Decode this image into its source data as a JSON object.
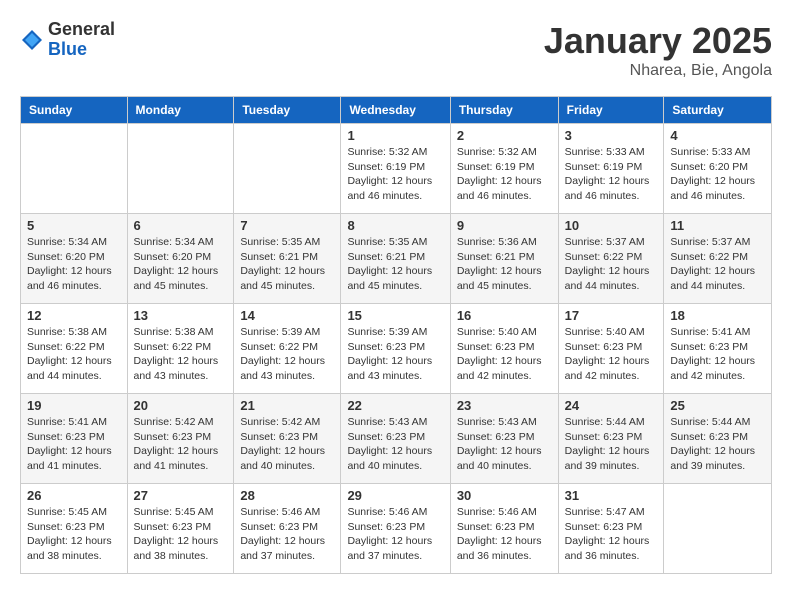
{
  "logo": {
    "general": "General",
    "blue": "Blue"
  },
  "header": {
    "month": "January 2025",
    "location": "Nharea, Bie, Angola"
  },
  "weekdays": [
    "Sunday",
    "Monday",
    "Tuesday",
    "Wednesday",
    "Thursday",
    "Friday",
    "Saturday"
  ],
  "weeks": [
    [
      {
        "day": "",
        "info": ""
      },
      {
        "day": "",
        "info": ""
      },
      {
        "day": "",
        "info": ""
      },
      {
        "day": "1",
        "info": "Sunrise: 5:32 AM\nSunset: 6:19 PM\nDaylight: 12 hours\nand 46 minutes."
      },
      {
        "day": "2",
        "info": "Sunrise: 5:32 AM\nSunset: 6:19 PM\nDaylight: 12 hours\nand 46 minutes."
      },
      {
        "day": "3",
        "info": "Sunrise: 5:33 AM\nSunset: 6:19 PM\nDaylight: 12 hours\nand 46 minutes."
      },
      {
        "day": "4",
        "info": "Sunrise: 5:33 AM\nSunset: 6:20 PM\nDaylight: 12 hours\nand 46 minutes."
      }
    ],
    [
      {
        "day": "5",
        "info": "Sunrise: 5:34 AM\nSunset: 6:20 PM\nDaylight: 12 hours\nand 46 minutes."
      },
      {
        "day": "6",
        "info": "Sunrise: 5:34 AM\nSunset: 6:20 PM\nDaylight: 12 hours\nand 45 minutes."
      },
      {
        "day": "7",
        "info": "Sunrise: 5:35 AM\nSunset: 6:21 PM\nDaylight: 12 hours\nand 45 minutes."
      },
      {
        "day": "8",
        "info": "Sunrise: 5:35 AM\nSunset: 6:21 PM\nDaylight: 12 hours\nand 45 minutes."
      },
      {
        "day": "9",
        "info": "Sunrise: 5:36 AM\nSunset: 6:21 PM\nDaylight: 12 hours\nand 45 minutes."
      },
      {
        "day": "10",
        "info": "Sunrise: 5:37 AM\nSunset: 6:22 PM\nDaylight: 12 hours\nand 44 minutes."
      },
      {
        "day": "11",
        "info": "Sunrise: 5:37 AM\nSunset: 6:22 PM\nDaylight: 12 hours\nand 44 minutes."
      }
    ],
    [
      {
        "day": "12",
        "info": "Sunrise: 5:38 AM\nSunset: 6:22 PM\nDaylight: 12 hours\nand 44 minutes."
      },
      {
        "day": "13",
        "info": "Sunrise: 5:38 AM\nSunset: 6:22 PM\nDaylight: 12 hours\nand 43 minutes."
      },
      {
        "day": "14",
        "info": "Sunrise: 5:39 AM\nSunset: 6:22 PM\nDaylight: 12 hours\nand 43 minutes."
      },
      {
        "day": "15",
        "info": "Sunrise: 5:39 AM\nSunset: 6:23 PM\nDaylight: 12 hours\nand 43 minutes."
      },
      {
        "day": "16",
        "info": "Sunrise: 5:40 AM\nSunset: 6:23 PM\nDaylight: 12 hours\nand 42 minutes."
      },
      {
        "day": "17",
        "info": "Sunrise: 5:40 AM\nSunset: 6:23 PM\nDaylight: 12 hours\nand 42 minutes."
      },
      {
        "day": "18",
        "info": "Sunrise: 5:41 AM\nSunset: 6:23 PM\nDaylight: 12 hours\nand 42 minutes."
      }
    ],
    [
      {
        "day": "19",
        "info": "Sunrise: 5:41 AM\nSunset: 6:23 PM\nDaylight: 12 hours\nand 41 minutes."
      },
      {
        "day": "20",
        "info": "Sunrise: 5:42 AM\nSunset: 6:23 PM\nDaylight: 12 hours\nand 41 minutes."
      },
      {
        "day": "21",
        "info": "Sunrise: 5:42 AM\nSunset: 6:23 PM\nDaylight: 12 hours\nand 40 minutes."
      },
      {
        "day": "22",
        "info": "Sunrise: 5:43 AM\nSunset: 6:23 PM\nDaylight: 12 hours\nand 40 minutes."
      },
      {
        "day": "23",
        "info": "Sunrise: 5:43 AM\nSunset: 6:23 PM\nDaylight: 12 hours\nand 40 minutes."
      },
      {
        "day": "24",
        "info": "Sunrise: 5:44 AM\nSunset: 6:23 PM\nDaylight: 12 hours\nand 39 minutes."
      },
      {
        "day": "25",
        "info": "Sunrise: 5:44 AM\nSunset: 6:23 PM\nDaylight: 12 hours\nand 39 minutes."
      }
    ],
    [
      {
        "day": "26",
        "info": "Sunrise: 5:45 AM\nSunset: 6:23 PM\nDaylight: 12 hours\nand 38 minutes."
      },
      {
        "day": "27",
        "info": "Sunrise: 5:45 AM\nSunset: 6:23 PM\nDaylight: 12 hours\nand 38 minutes."
      },
      {
        "day": "28",
        "info": "Sunrise: 5:46 AM\nSunset: 6:23 PM\nDaylight: 12 hours\nand 37 minutes."
      },
      {
        "day": "29",
        "info": "Sunrise: 5:46 AM\nSunset: 6:23 PM\nDaylight: 12 hours\nand 37 minutes."
      },
      {
        "day": "30",
        "info": "Sunrise: 5:46 AM\nSunset: 6:23 PM\nDaylight: 12 hours\nand 36 minutes."
      },
      {
        "day": "31",
        "info": "Sunrise: 5:47 AM\nSunset: 6:23 PM\nDaylight: 12 hours\nand 36 minutes."
      },
      {
        "day": "",
        "info": ""
      }
    ]
  ]
}
